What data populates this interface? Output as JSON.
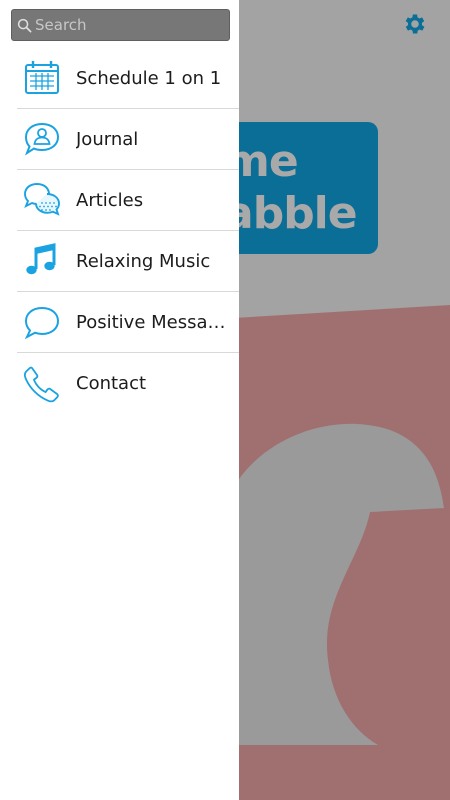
{
  "app": {
    "logo_line1": "me",
    "logo_line2": "abble"
  },
  "header": {
    "settings_icon": "gear-icon"
  },
  "drawer": {
    "search": {
      "placeholder": "Search",
      "value": ""
    },
    "items": [
      {
        "label": "Schedule 1 on 1",
        "icon": "calendar-icon"
      },
      {
        "label": "Journal",
        "icon": "person-bubble-icon"
      },
      {
        "label": "Articles",
        "icon": "chat-bubbles-icon"
      },
      {
        "label": "Relaxing Music",
        "icon": "music-note-icon"
      },
      {
        "label": "Positive Messag...",
        "icon": "speech-bubble-icon"
      },
      {
        "label": "Contact",
        "icon": "phone-icon"
      }
    ]
  },
  "colors": {
    "accent": "#1aa3e0",
    "search_bg": "#777777",
    "overlay": "#9d9d9d",
    "pink": "#a87474"
  }
}
